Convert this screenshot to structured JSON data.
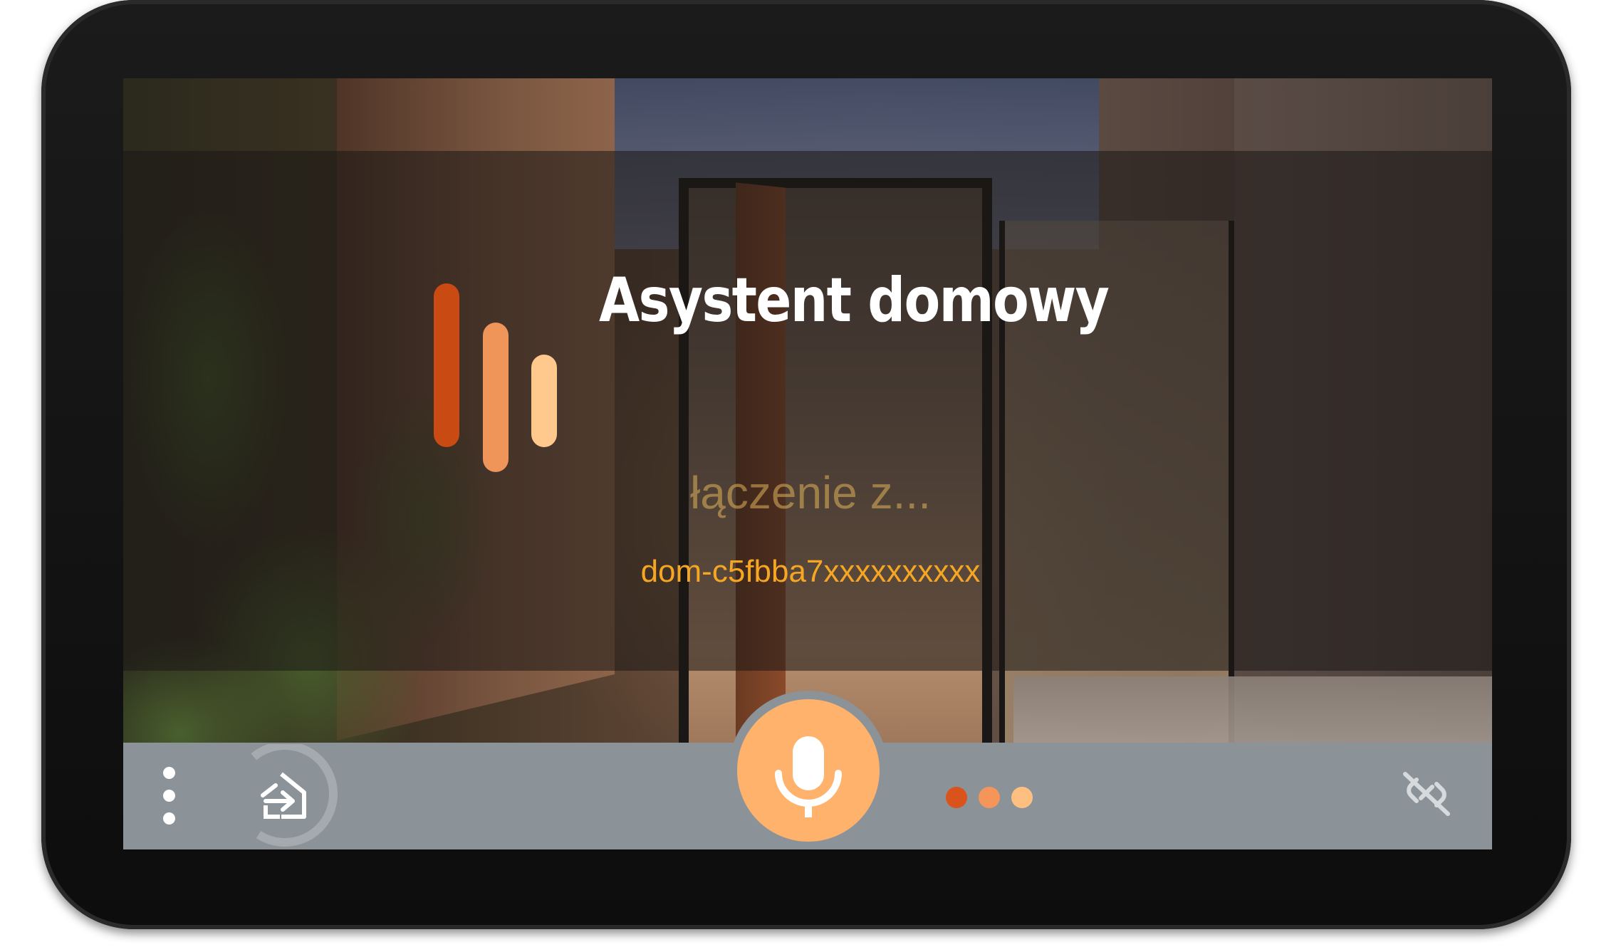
{
  "app": {
    "title": "Asystent domowy",
    "status": "łączenie z...",
    "device_id": "dom-c5fbba7xxxxxxxxxx"
  },
  "logo": {
    "colors": [
      "#c94a12",
      "#f0955a",
      "#ffc88c"
    ]
  },
  "bottom_bar": {
    "background_color": "#8c9398",
    "menu_icon": "more-vert-icon",
    "home_icon": "home-login-icon",
    "mic_icon": "microphone-icon",
    "mic_color": "#ffb26b",
    "connection_icon": "link-off-icon",
    "page_indicator": {
      "count": 3,
      "active_index": 0,
      "colors": [
        "#d9531a",
        "#f5955a",
        "#ffbf80"
      ]
    }
  }
}
